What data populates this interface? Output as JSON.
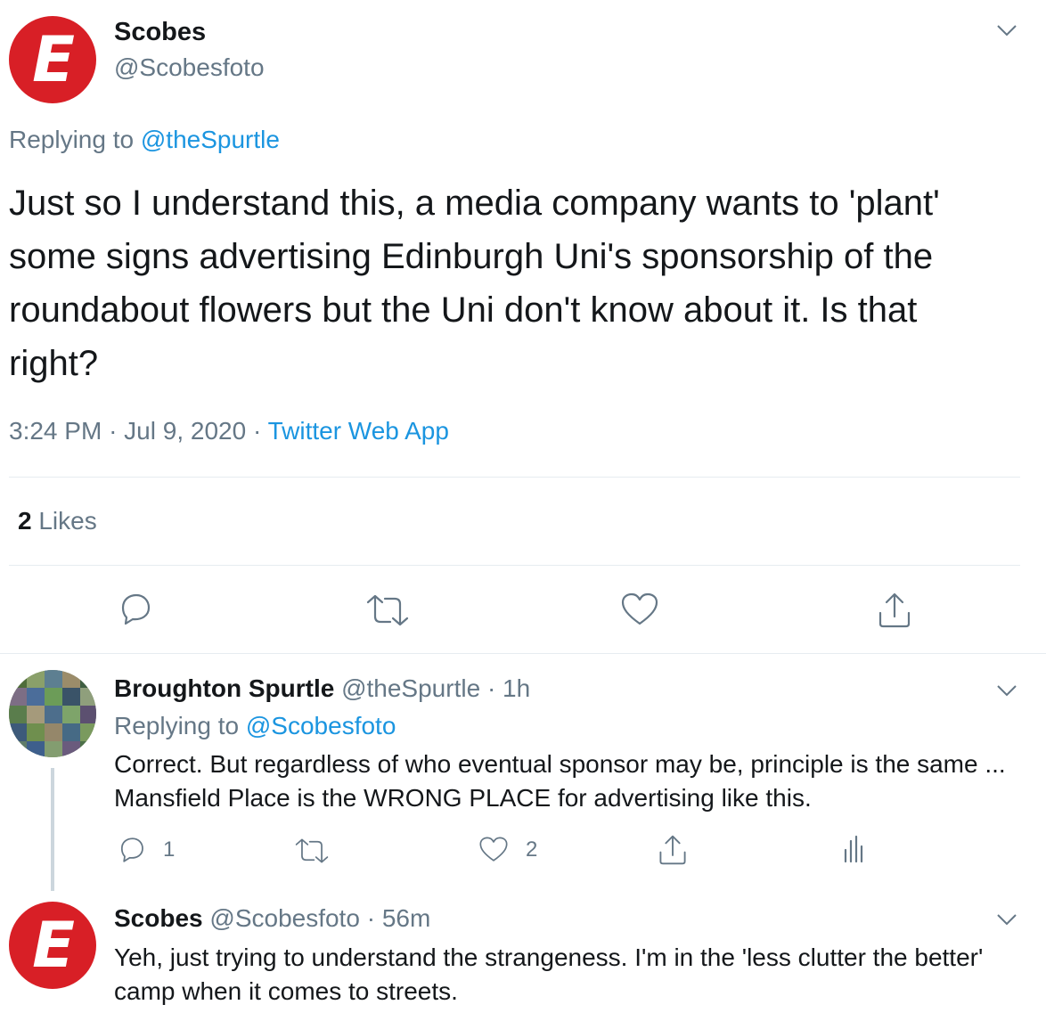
{
  "main_tweet": {
    "author_name": "Scobes",
    "author_handle": "@Scobesfoto",
    "avatar_letter": "E",
    "replying_prefix": "Replying to",
    "replying_to": "@theSpurtle",
    "text": "Just so I understand this, a media company wants to 'plant' some signs advertising Edinburgh Uni's sponsorship of the roundabout flowers but the Uni don't know about it. Is that right?",
    "time": "3:24 PM",
    "separator1": "·",
    "date": "Jul 9, 2020",
    "separator2": "·",
    "source": "Twitter Web App",
    "likes_count": "2",
    "likes_label": "Likes"
  },
  "reply1": {
    "author_name": "Broughton Spurtle",
    "author_handle": "@theSpurtle",
    "separator": "·",
    "time_ago": "1h",
    "replying_prefix": "Replying to",
    "replying_to": "@Scobesfoto",
    "text": "Correct. But regardless of who eventual sponsor may be, principle is the same ... Mansfield Place is the WRONG PLACE for advertising like this.",
    "reply_count": "1",
    "like_count": "2"
  },
  "reply2": {
    "author_name": "Scobes",
    "author_handle": "@Scobesfoto",
    "separator": "·",
    "time_ago": "56m",
    "avatar_letter": "E",
    "text": "Yeh, just trying to understand the strangeness. I'm in the 'less clutter the better' camp when it comes to streets."
  },
  "colors": {
    "accent": "#1b95e0",
    "secondary_text": "#657786",
    "avatar_red": "#d81f26",
    "divider": "#e6ecf0"
  },
  "icons": [
    "chevron-down-icon",
    "reply-icon",
    "retweet-icon",
    "like-icon",
    "share-icon",
    "analytics-icon"
  ]
}
